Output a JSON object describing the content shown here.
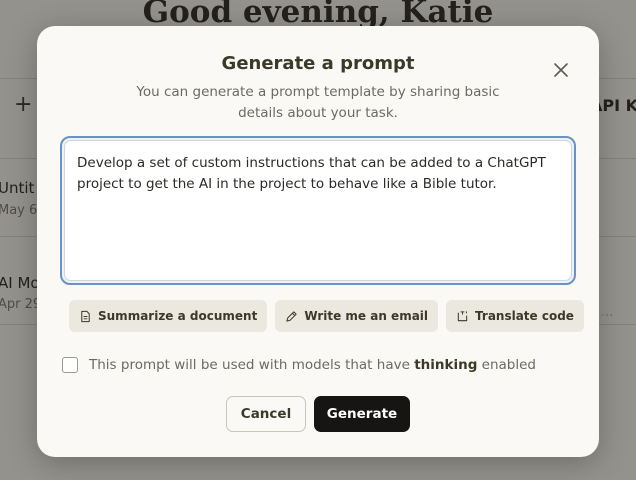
{
  "background": {
    "greeting": "Good evening, Katie",
    "plus_symbol": "+",
    "right_label": "API Ke",
    "projects": [
      {
        "title": "Untit",
        "date": "May 6"
      },
      {
        "title": "AI Mo",
        "date": "Apr 29"
      }
    ]
  },
  "modal": {
    "title": "Generate a prompt",
    "subtitle": "You can generate a prompt template by sharing basic details about your task.",
    "task_input": {
      "value": "Develop a set of custom instructions that can be added to a ChatGPT project to get the AI in the project to behave like a Bible tutor.",
      "placeholder": ""
    },
    "suggestions": [
      {
        "label": "Summarize a document",
        "icon": "document-icon"
      },
      {
        "label": "Write me an email",
        "icon": "pen-icon"
      },
      {
        "label": "Translate code",
        "icon": "code-icon"
      }
    ],
    "more_label": "···",
    "thinking_checkbox": {
      "checked": false,
      "text_before": "This prompt will be used with models that have ",
      "text_bold": "thinking",
      "text_after": " enabled"
    },
    "cancel_label": "Cancel",
    "generate_label": "Generate"
  },
  "colors": {
    "modal_bg": "#faf9f5",
    "primary_button": "#161513",
    "focus_border": "#6a93c4"
  }
}
